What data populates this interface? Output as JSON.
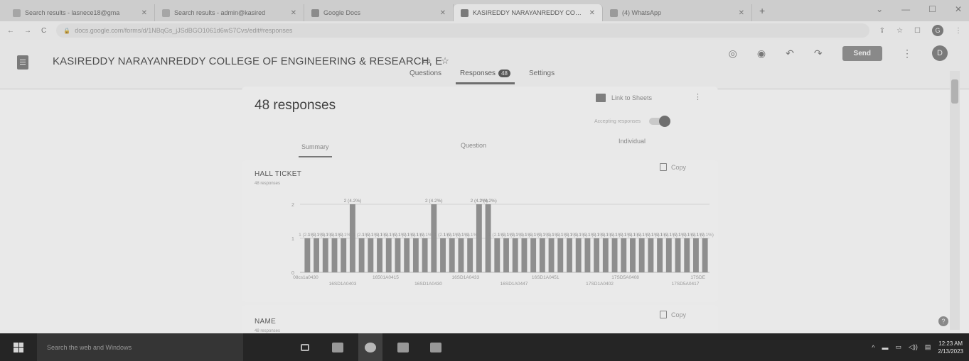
{
  "browser": {
    "tabs": [
      {
        "title": "Search results - lasnece18@gma",
        "color": "#a9a9a9",
        "active": false
      },
      {
        "title": "Search results - admin@kasired",
        "color": "#a9a9a9",
        "active": false
      },
      {
        "title": "Google Docs",
        "color": "#8c8c8c",
        "active": false
      },
      {
        "title": "KASIREDDY NARAYANREDDY COLLE",
        "color": "#7a7a7a",
        "active": true
      },
      {
        "title": "(4) WhatsApp",
        "color": "#9c9c9c",
        "active": false
      }
    ],
    "new_tab": "+",
    "window_controls": [
      "⌄",
      "—",
      "☐",
      "✕"
    ],
    "url": "docs.google.com/forms/d/1NBqGs_jJSdBGO1061d6wS7Cvs/edit#responses",
    "nav": [
      "←",
      "→",
      "C"
    ],
    "lock": "🔒",
    "addr_icons": [
      "⇪",
      "☆",
      "☐"
    ],
    "profile_initial": "G"
  },
  "form": {
    "title": "KASIREDDY NARAYANREDDY COLLEGE OF ENGINEERING & RESEARCH, E",
    "title_icons": [
      "▭",
      "☆"
    ],
    "actions": [
      "◎",
      "◉",
      "↶",
      "↷"
    ],
    "send_label": "Send",
    "kebab": "⋮",
    "avatar_initial": "D",
    "tabs": {
      "questions": "Questions",
      "responses": "Responses",
      "responses_badge": "48",
      "settings": "Settings"
    }
  },
  "summary": {
    "count_text": "48 responses",
    "sheets_link": "Link to Sheets",
    "kebab": "⋮",
    "accepting_label": "Accepting responses",
    "accepting": true,
    "tabs": {
      "summary": "Summary",
      "question": "Question",
      "individual": "Individual"
    }
  },
  "hall_ticket": {
    "title": "HALL TICKET",
    "subtitle": "48 responses",
    "copy_label": "Copy"
  },
  "name_card": {
    "title": "NAME",
    "subtitle": "48 responses",
    "copy_label": "Copy"
  },
  "help": "?",
  "chart_data": {
    "type": "bar",
    "ylim": [
      0,
      2
    ],
    "yticks": [
      "0",
      "1",
      "2"
    ],
    "values": [
      1,
      1,
      1,
      1,
      1,
      2,
      1,
      1,
      1,
      1,
      1,
      1,
      1,
      1,
      2,
      1,
      1,
      1,
      1,
      2,
      2,
      1,
      1,
      1,
      1,
      1,
      1,
      1,
      1,
      1,
      1,
      1,
      1,
      1,
      1,
      1,
      1,
      1,
      1,
      1,
      1,
      1,
      1,
      1,
      1
    ],
    "bar_labels": {
      "1": "1 (2.1%)",
      "2": "2 (4.2%)"
    },
    "x_tick_labels_row1": [
      "08cs1a0430",
      "16501A0415",
      "16SD1A0433",
      "16SD1A0451",
      "17SD5A0408",
      "17SDE"
    ],
    "x_tick_labels_row2": [
      "16SD1A0403",
      "16SD1A0430",
      "16SD1A0447",
      "17SD1A0402",
      "17SD5A0417"
    ],
    "color": "#8f8f8f"
  },
  "taskbar": {
    "search_text": "Search the web and Windows",
    "tray_icons": [
      "^",
      "▬",
      "▭",
      "◁))",
      "▤"
    ],
    "time": "12:23 AM",
    "date": "2/13/2023"
  }
}
